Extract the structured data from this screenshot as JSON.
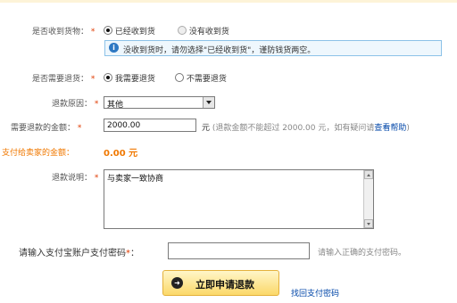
{
  "received": {
    "label": "是否收到货物：",
    "required": "*",
    "opt_yes": "已经收到货",
    "opt_no": "没有收到货",
    "info_icon": "i",
    "info_text": "没收到货时，请勿选择\"已经收到货\"，谨防钱货两空。"
  },
  "need_return": {
    "label": "是否需要退货：",
    "required": "*",
    "opt_yes": "我需要退货",
    "opt_no": "不需要退货"
  },
  "reason": {
    "label": "退款原因：",
    "required": "*",
    "selected": "其他"
  },
  "amount": {
    "label": "需要退款的金额：",
    "required": "*",
    "value": "2000.00",
    "unit": "元",
    "hint_prefix": "(退款金额不能超过",
    "hint_max": "2000.00",
    "hint_unit": "元，如有疑问请",
    "hint_link": "查看帮助",
    "hint_close": ")"
  },
  "seller_amount": {
    "label": "支付给卖家的金额：",
    "value": "0.00 元"
  },
  "description": {
    "label": "退款说明：",
    "required": "*",
    "value": "与卖家一致协商"
  },
  "password": {
    "label": "请输入支付宝账户支付密码",
    "required": "*",
    "colon": "：",
    "hint": "请输入正确的支付密码。"
  },
  "actions": {
    "submit_label": "立即申请退款",
    "submit_icon": "➜",
    "forgot_label": "找回支付密码"
  },
  "colors": {
    "required": "#e03a00",
    "seller_amount": "#f07800",
    "link": "#0046a8",
    "info_border": "#8cc2e8",
    "button_border": "#e4b13c"
  }
}
